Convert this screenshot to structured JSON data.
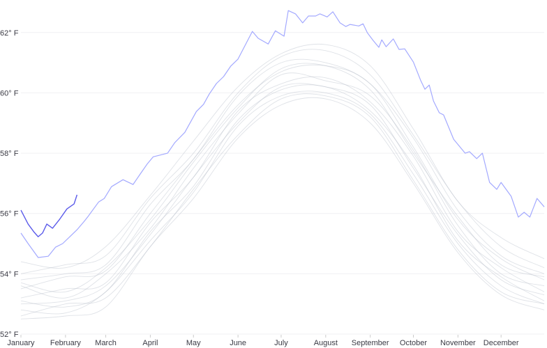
{
  "chart_data": {
    "type": "line",
    "title": "",
    "xlabel": "",
    "ylabel": "",
    "ylim": [
      52,
      63.08
    ],
    "y_ticks": [
      {
        "value": 52,
        "label": "52° F"
      },
      {
        "value": 54,
        "label": "54° F"
      },
      {
        "value": 56,
        "label": "56° F"
      },
      {
        "value": 58,
        "label": "58° F"
      },
      {
        "value": 60,
        "label": "60° F"
      },
      {
        "value": 62,
        "label": "62° F"
      }
    ],
    "x_ticks": [
      "January",
      "February",
      "March",
      "April",
      "May",
      "June",
      "July",
      "August",
      "September",
      "October",
      "November",
      "December"
    ],
    "grid": "horizontal",
    "colors": {
      "other_years": "#b9bec9",
      "highlight_year": "#a3a9ff",
      "current_year": "#5b5bea",
      "grid": "#f0f0f3",
      "text": "#3a3a44"
    },
    "background_dates": [
      "Jan 1",
      "Feb 1",
      "Mar 1",
      "Apr 1",
      "May 1",
      "Jun 1",
      "Jul 1",
      "Aug 1",
      "Sep 1",
      "Oct 1",
      "Nov 1",
      "Dec 1",
      "Dec 31"
    ],
    "background_series": [
      [
        54.4,
        54.2,
        54.9,
        56.6,
        58.4,
        60.2,
        61.3,
        61.6,
        60.9,
        58.8,
        56.4,
        55.2,
        54.5
      ],
      [
        53.8,
        54.0,
        54.3,
        56.3,
        57.8,
        59.9,
        61.0,
        61.0,
        60.3,
        58.5,
        56.1,
        54.6,
        54.0
      ],
      [
        53.7,
        53.4,
        54.2,
        55.8,
        57.7,
        59.5,
        60.8,
        60.9,
        60.1,
        58.0,
        55.9,
        54.3,
        53.9
      ],
      [
        53.2,
        53.5,
        53.7,
        55.7,
        57.2,
        59.4,
        60.3,
        60.5,
        59.7,
        57.9,
        55.4,
        54.2,
        53.4
      ],
      [
        53.0,
        53.1,
        53.6,
        55.3,
        57.2,
        59.0,
        60.2,
        60.2,
        59.6,
        57.5,
        55.3,
        53.8,
        53.3
      ],
      [
        52.8,
        52.7,
        53.4,
        55.1,
        56.7,
        58.9,
        59.9,
        60.0,
        59.3,
        57.3,
        55.0,
        53.6,
        53.0
      ],
      [
        52.5,
        52.6,
        52.9,
        54.9,
        56.5,
        58.5,
        59.6,
        59.8,
        59.0,
        57.0,
        54.7,
        53.3,
        52.8
      ],
      [
        53.6,
        53.2,
        54.0,
        55.5,
        57.5,
        59.3,
        60.6,
        60.4,
        59.9,
        58.1,
        55.6,
        54.0,
        53.6
      ],
      [
        54.0,
        54.3,
        54.6,
        56.5,
        58.0,
        60.0,
        61.2,
        61.4,
        60.6,
        58.6,
        56.4,
        54.9,
        54.2
      ],
      [
        53.1,
        52.9,
        53.4,
        55.4,
        56.9,
        59.1,
        60.1,
        60.2,
        59.4,
        57.6,
        55.1,
        53.9,
        53.1
      ],
      [
        53.5,
        53.9,
        54.1,
        56.0,
        57.8,
        59.6,
        60.7,
        60.9,
        60.3,
        58.2,
        55.8,
        54.5,
        53.8
      ],
      [
        52.6,
        53.0,
        53.2,
        54.9,
        56.8,
        58.6,
        59.8,
        59.9,
        59.2,
        57.1,
        54.8,
        53.4,
        53.0
      ]
    ],
    "highlight_series": [
      [
        "Jan 1",
        55.35
      ],
      [
        "Jan 6",
        55.0
      ],
      [
        "Jan 13",
        54.54
      ],
      [
        "Jan 20",
        54.58
      ],
      [
        "Jan 25",
        54.88
      ],
      [
        "Jan 30",
        55.0
      ],
      [
        "Feb 4",
        55.23
      ],
      [
        "Feb 9",
        55.46
      ],
      [
        "Feb 14",
        55.74
      ],
      [
        "Feb 17",
        55.92
      ],
      [
        "Feb 24",
        56.38
      ],
      [
        "Feb 28",
        56.5
      ],
      [
        "Mar 5",
        56.89
      ],
      [
        "Mar 13",
        57.12
      ],
      [
        "Mar 20",
        56.96
      ],
      [
        "Mar 25",
        57.31
      ],
      [
        "Mar 30",
        57.65
      ],
      [
        "Apr 3",
        57.88
      ],
      [
        "Apr 13",
        58.0
      ],
      [
        "Apr 18",
        58.35
      ],
      [
        "Apr 25",
        58.69
      ],
      [
        "May 3",
        59.38
      ],
      [
        "May 8",
        59.62
      ],
      [
        "May 12",
        59.96
      ],
      [
        "May 17",
        60.31
      ],
      [
        "May 22",
        60.54
      ],
      [
        "May 27",
        60.89
      ],
      [
        "Jun 1",
        61.12
      ],
      [
        "Jun 6",
        61.58
      ],
      [
        "Jun 11",
        62.04
      ],
      [
        "Jun 15",
        61.81
      ],
      [
        "Jun 22",
        61.62
      ],
      [
        "Jun 27",
        62.06
      ],
      [
        "Jul 3",
        61.88
      ],
      [
        "Jul 6",
        62.73
      ],
      [
        "Jul 11",
        62.62
      ],
      [
        "Jul 16",
        62.32
      ],
      [
        "Jul 20",
        62.55
      ],
      [
        "Jul 25",
        62.55
      ],
      [
        "Jul 28",
        62.62
      ],
      [
        "Aug 2",
        62.52
      ],
      [
        "Aug 6",
        62.69
      ],
      [
        "Aug 11",
        62.32
      ],
      [
        "Aug 15",
        62.2
      ],
      [
        "Aug 18",
        62.27
      ],
      [
        "Aug 24",
        62.22
      ],
      [
        "Aug 27",
        62.29
      ],
      [
        "Aug 30",
        61.99
      ],
      [
        "Sep 3",
        61.74
      ],
      [
        "Sep 7",
        61.51
      ],
      [
        "Sep 9",
        61.76
      ],
      [
        "Sep 12",
        61.53
      ],
      [
        "Sep 17",
        61.79
      ],
      [
        "Sep 21",
        61.44
      ],
      [
        "Sep 25",
        61.46
      ],
      [
        "Oct 1",
        61.02
      ],
      [
        "Oct 6",
        60.42
      ],
      [
        "Oct 9",
        60.12
      ],
      [
        "Oct 12",
        60.26
      ],
      [
        "Oct 15",
        59.73
      ],
      [
        "Oct 19",
        59.34
      ],
      [
        "Oct 22",
        59.27
      ],
      [
        "Oct 29",
        58.46
      ],
      [
        "Nov 6",
        58.0
      ],
      [
        "Nov 9",
        58.05
      ],
      [
        "Nov 14",
        57.82
      ],
      [
        "Nov 18",
        58.0
      ],
      [
        "Nov 23",
        57.03
      ],
      [
        "Nov 28",
        56.8
      ],
      [
        "Dec 1",
        57.03
      ],
      [
        "Dec 8",
        56.57
      ],
      [
        "Dec 13",
        55.88
      ],
      [
        "Dec 17",
        56.04
      ],
      [
        "Dec 21",
        55.88
      ],
      [
        "Dec 26",
        56.5
      ],
      [
        "Dec 31",
        56.22
      ]
    ],
    "current_series": [
      [
        "Jan 1",
        56.11
      ],
      [
        "Jan 6",
        55.65
      ],
      [
        "Jan 10",
        55.39
      ],
      [
        "Jan 13",
        55.23
      ],
      [
        "Jan 16",
        55.35
      ],
      [
        "Jan 19",
        55.65
      ],
      [
        "Jan 23",
        55.51
      ],
      [
        "Jan 28",
        55.81
      ],
      [
        "Feb 2",
        56.15
      ],
      [
        "Feb 7",
        56.32
      ],
      [
        "Feb 9",
        56.62
      ]
    ]
  }
}
